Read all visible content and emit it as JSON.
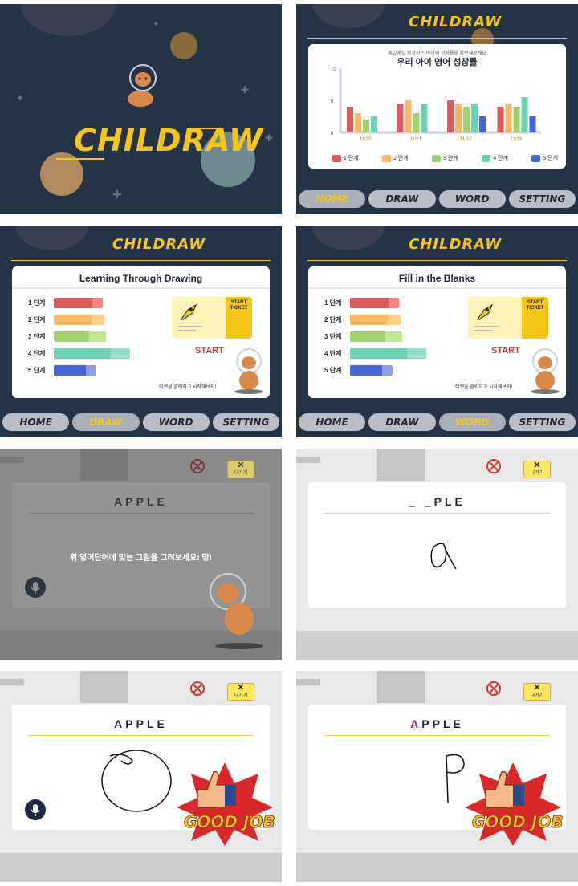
{
  "app": {
    "logo": "CHILDRAW"
  },
  "nav": {
    "home": "HOME",
    "draw": "DRAW",
    "word": "WORD",
    "setting": "SETTING"
  },
  "growth": {
    "subtitle": "매일매일 성장하는 아이의 성장률을 확인해보세요",
    "title": "우리 아이 영어 성장률"
  },
  "chart_data": {
    "type": "bar",
    "title": "우리 아이 영어 성장률",
    "categories": [
      "11/20",
      "11/21",
      "11/22",
      "11/23"
    ],
    "y_ticks": [
      "10",
      "5",
      "0"
    ],
    "ylim": [
      0,
      10
    ],
    "series": [
      {
        "name": "1 단계",
        "color": "#e05a5a",
        "values": [
          4,
          4.5,
          5,
          4
        ]
      },
      {
        "name": "2 단계",
        "color": "#f7b966",
        "values": [
          3,
          5,
          4.5,
          4.5
        ]
      },
      {
        "name": "3 단계",
        "color": "#9fd36a",
        "values": [
          2,
          3,
          4,
          4
        ]
      },
      {
        "name": "4 단계",
        "color": "#6fd0b8",
        "values": [
          2.5,
          4.5,
          4.5,
          5.5
        ]
      },
      {
        "name": "5 단계",
        "color": "#4666d6",
        "values": [
          0,
          0,
          2.5,
          2.5
        ]
      }
    ],
    "legend": "bottom"
  },
  "drawing_levels": {
    "title": "Learning Through Drawing",
    "levels": [
      {
        "label": "1 단계",
        "color": "#e05a5a",
        "light": "#ff8080",
        "value": 0.8
      },
      {
        "label": "2 단계",
        "color": "#f7b966",
        "light": "#ffd08a",
        "value": 0.75
      },
      {
        "label": "3 단계",
        "color": "#9fd36a",
        "light": "#bfe58f",
        "value": 0.68
      },
      {
        "label": "4 단계",
        "color": "#6fd0b8",
        "light": "#92e0cb",
        "value": 0.75
      },
      {
        "label": "5 단계",
        "color": "#4666d6",
        "light": "#8f9fe6",
        "value": 0.75
      }
    ],
    "ticket_label": "START TICKET",
    "start": "START",
    "hint": "티켓을 클릭하고 시작해보자!"
  },
  "word_levels": {
    "title": "Fill in the Blanks",
    "levels": [
      {
        "label": "1 단계",
        "color": "#e05a5a",
        "light": "#ff8080",
        "value": 0.8
      },
      {
        "label": "2 단계",
        "color": "#f7b966",
        "light": "#ffd08a",
        "value": 0.75
      },
      {
        "label": "3 단계",
        "color": "#9fd36a",
        "light": "#bfe58f",
        "value": 0.68
      },
      {
        "label": "4 단계",
        "color": "#6fd0b8",
        "light": "#92e0cb",
        "value": 0.75
      },
      {
        "label": "5 단계",
        "color": "#4666d6",
        "light": "#8f9fe6",
        "value": 0.75
      }
    ],
    "ticket_label": "START TICKET",
    "start": "START",
    "hint": "티켓을 클릭하고 시작해보자!"
  },
  "game": {
    "exit_label": "나가기",
    "word_apple": "APPLE",
    "word_blank": "_ _PLE",
    "word_highlight_first": "A",
    "word_highlight_rest": "PPLE",
    "instruction": "위 영어단어에 맞는 그림을 그려보세요! 멍!",
    "good_job": "GOOD JOB"
  },
  "icons": [
    "mic-icon",
    "rocket-icon",
    "close-icon",
    "dog-astronaut-icon",
    "thumbs-up-icon"
  ]
}
